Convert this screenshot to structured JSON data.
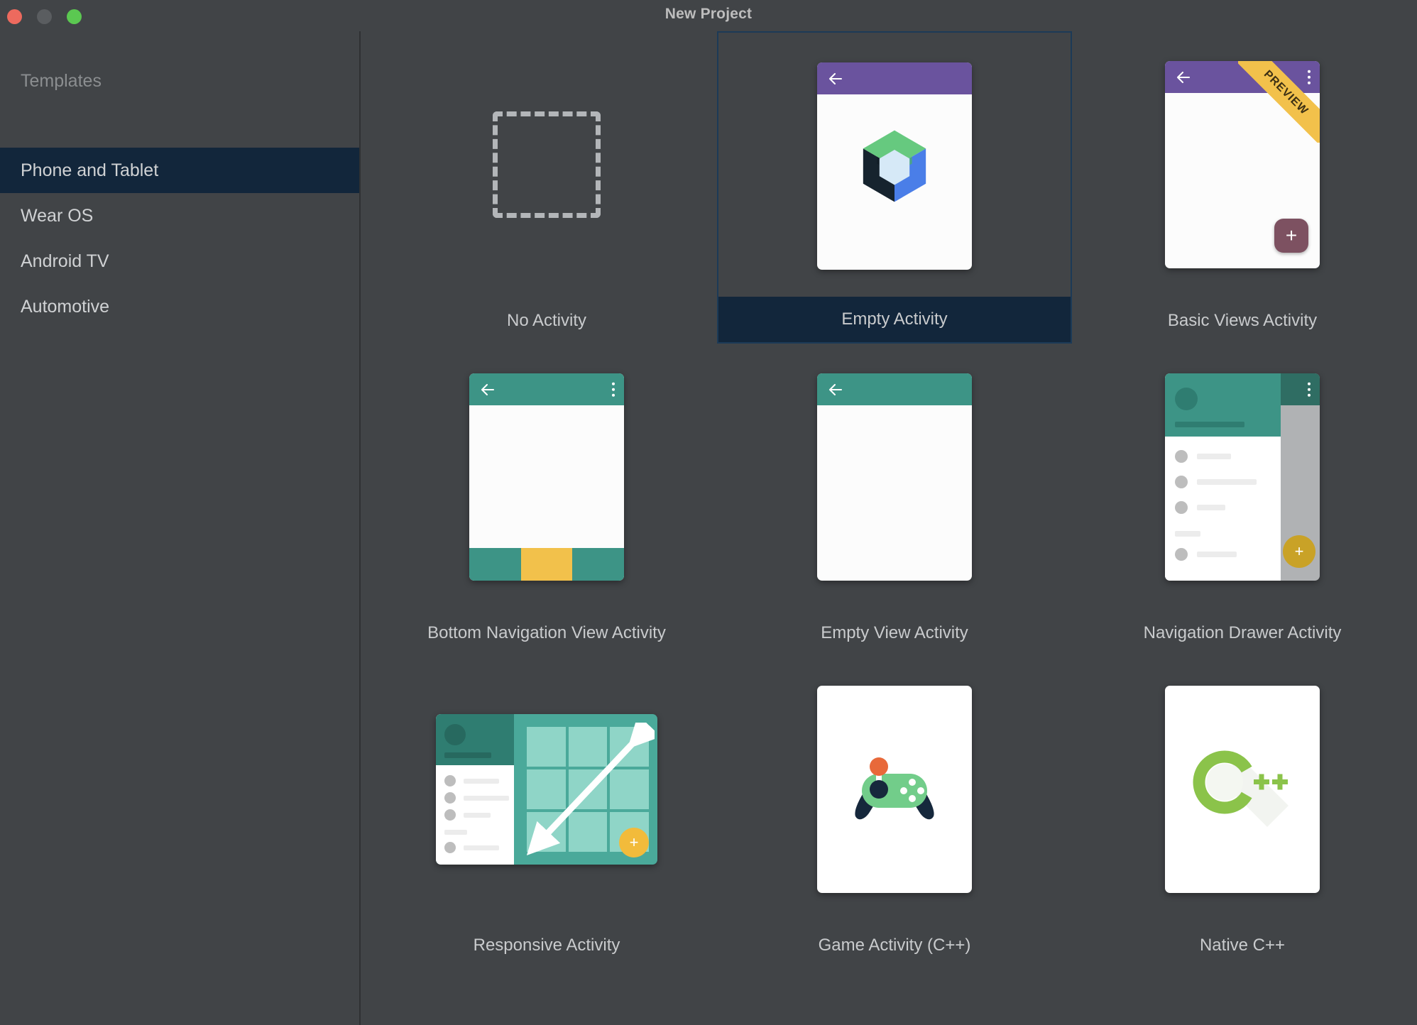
{
  "window": {
    "title": "New Project",
    "controls": [
      {
        "name": "close",
        "color": "#ed6a5e"
      },
      {
        "name": "minimize",
        "color": "#5a5d60"
      },
      {
        "name": "zoom",
        "color": "#5bc851"
      }
    ]
  },
  "sidebar": {
    "header": "Templates",
    "items": [
      {
        "label": "Phone and Tablet",
        "selected": true
      },
      {
        "label": "Wear OS",
        "selected": false
      },
      {
        "label": "Android TV",
        "selected": false
      },
      {
        "label": "Automotive",
        "selected": false
      }
    ]
  },
  "templates": [
    {
      "label": "No Activity",
      "thumb": "dashed-placeholder",
      "selected": false
    },
    {
      "label": "Empty Activity",
      "thumb": "compose-logo",
      "selected": true,
      "appbar_color": "#6a539e"
    },
    {
      "label": "Basic Views Activity",
      "thumb": "basic-views",
      "selected": false,
      "appbar_color": "#6a539e",
      "badge": "PREVIEW"
    },
    {
      "label": "Bottom Navigation View Activity",
      "thumb": "bottom-navigation",
      "selected": false,
      "appbar_color": "#3d9486"
    },
    {
      "label": "Empty View Activity",
      "thumb": "empty-view",
      "selected": false,
      "appbar_color": "#3d9486"
    },
    {
      "label": "Navigation Drawer Activity",
      "thumb": "navigation-drawer",
      "selected": false,
      "appbar_color": "#3d9486"
    },
    {
      "label": "Responsive Activity",
      "thumb": "responsive-layout",
      "selected": false,
      "appbar_color": "#2f7d71"
    },
    {
      "label": "Game Activity (C++)",
      "thumb": "gamepad-logo",
      "selected": false
    },
    {
      "label": "Native C++",
      "thumb": "cpp-logo",
      "selected": false
    }
  ],
  "badges": {
    "preview": "PREVIEW"
  },
  "icons": {
    "fab_plus": "+",
    "cpp_plusplus": "++"
  },
  "colors": {
    "background": "#414447",
    "selection": "#12263b",
    "selection_border": "#1c3a57",
    "accent_purple": "#6a539e",
    "accent_teal": "#3d9486",
    "accent_yellow": "#f2c14b",
    "accent_gold": "#c9a227",
    "accent_green": "#7bc96f",
    "accent_orange": "#e8693a",
    "text_primary": "#c9cbcd",
    "text_muted": "#8b8e90"
  }
}
